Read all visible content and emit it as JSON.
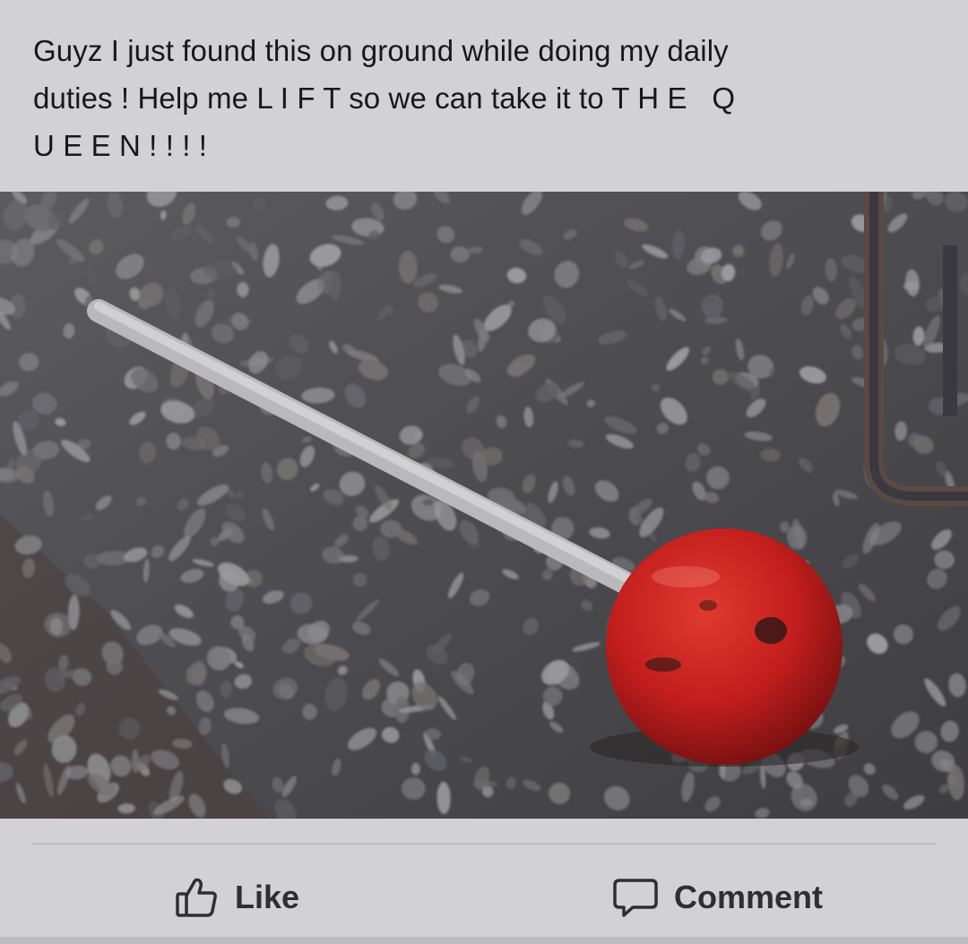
{
  "post": {
    "text_line1": "Guyz I just found this on ground while doing my daily",
    "text_line2": "duties ! Help me L I F T so we can take it to T H E   Q",
    "text_line3": "U E E N ! ! ! !"
  },
  "photo": {
    "icon": "photo-lollipop-on-gravel"
  },
  "actions": {
    "like_label": "Like",
    "like_icon": "thumbs-up-icon",
    "comment_label": "Comment",
    "comment_icon": "speech-bubble-icon"
  },
  "colors": {
    "background": "#d2d2d4",
    "text": "#18181a",
    "action_text": "#2e2f33",
    "candy_red": "#c21e1c"
  }
}
